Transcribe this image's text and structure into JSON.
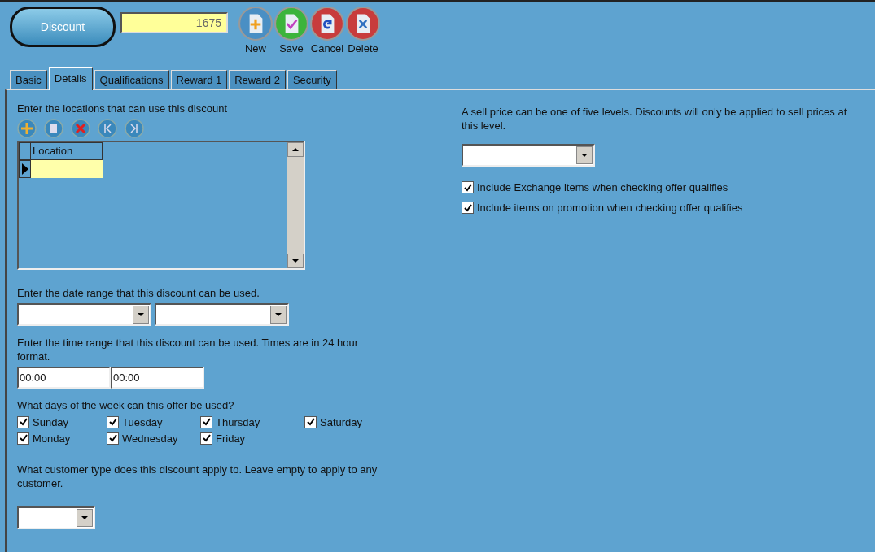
{
  "header": {
    "title": "Discount",
    "record_id": "1675"
  },
  "toolbar": [
    {
      "label": "New",
      "kind": "new"
    },
    {
      "label": "Save",
      "kind": "save"
    },
    {
      "label": "Cancel",
      "kind": "cancel"
    },
    {
      "label": "Delete",
      "kind": "delete"
    }
  ],
  "tabs": [
    {
      "label": "Basic",
      "selected": false
    },
    {
      "label": "Details",
      "selected": true
    },
    {
      "label": "Qualifications",
      "selected": false
    },
    {
      "label": "Reward 1",
      "selected": false
    },
    {
      "label": "Reward 2",
      "selected": false
    },
    {
      "label": "Security",
      "selected": false
    }
  ],
  "locations": {
    "prompt": "Enter the locations that can use this discount",
    "tools": [
      {
        "kind": "add"
      },
      {
        "kind": "edit"
      },
      {
        "kind": "remove"
      },
      {
        "kind": "first"
      },
      {
        "kind": "last"
      }
    ],
    "grid": {
      "columns": [
        "Location"
      ]
    }
  },
  "date_range": {
    "prompt": "Enter the date range that this discount can be used."
  },
  "time_range": {
    "prompt": "Enter the time range that this discount can be used. Times are in 24 hour format.",
    "from": "00:00",
    "to": "00:00"
  },
  "days": {
    "prompt": "What days of the week can this offer be used?",
    "items": [
      {
        "label": "Sunday",
        "checked": true
      },
      {
        "label": "Monday",
        "checked": true
      },
      {
        "label": "Tuesday",
        "checked": true
      },
      {
        "label": "Wednesday",
        "checked": true
      },
      {
        "label": "Thursday",
        "checked": true
      },
      {
        "label": "Friday",
        "checked": true
      },
      {
        "label": "Saturday",
        "checked": true
      }
    ]
  },
  "customer_type": {
    "prompt": "What customer type does this discount apply to. Leave empty to apply to any customer."
  },
  "price_level": {
    "prompt": "A sell price can be one of five levels. Discounts will only be applied to sell prices at this level."
  },
  "options": [
    {
      "label": "Include Exchange items when checking offer qualifies",
      "checked": true
    },
    {
      "label": "Include items on promotion when checking offer qualifies",
      "checked": true
    }
  ]
}
